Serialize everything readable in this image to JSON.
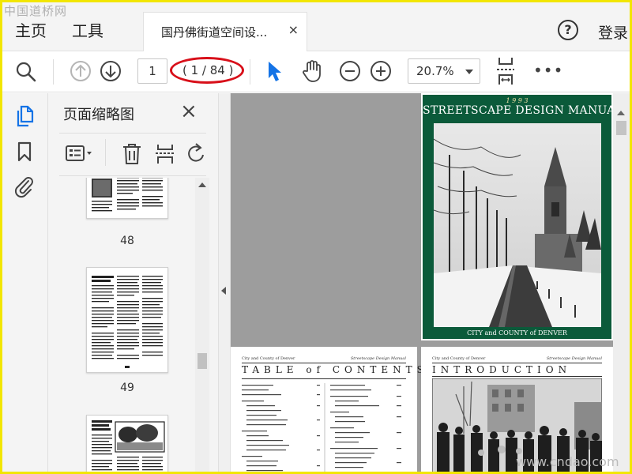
{
  "watermark_top": "中国道桥网",
  "watermark_bottom": "www.cndao.com",
  "menu": {
    "home": "主页",
    "tools": "工具"
  },
  "tab": {
    "title": "国丹佛街道空间设...",
    "close": "×"
  },
  "header": {
    "help": "?",
    "login": "登录"
  },
  "toolbar": {
    "page_current": "1",
    "page_count": "( 1 / 84 )",
    "zoom": "20.7%",
    "more": "•••"
  },
  "panel": {
    "title": "页面缩略图",
    "close": "×",
    "thumbnails": [
      {
        "label": "48"
      },
      {
        "label": "49"
      }
    ]
  },
  "cover": {
    "year": "1 9 9 3",
    "title": "STREETSCAPE DESIGN MANUAL",
    "footer": "CITY and COUNTY of DENVER"
  },
  "page2": {
    "header_left": "City and County of Denver",
    "header_right": "Streetscape Design Manual",
    "title": "TABLE of CONTENTS"
  },
  "page3": {
    "header_left": "City and County of Denver",
    "header_right": "Streetscape Design Manual",
    "title": "INTRODUCTION"
  },
  "colors": {
    "highlight_oval": "#d8101a",
    "cursor_blue": "#1473e6",
    "cover_green": "#0b5a3a",
    "frame_yellow": "#f2e600"
  }
}
